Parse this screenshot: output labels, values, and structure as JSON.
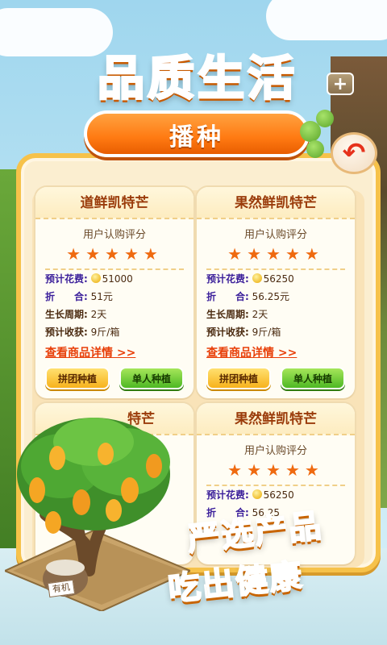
{
  "headline": "品质生活",
  "tab_label": "播种",
  "back_icon": "back-arrow-icon",
  "plus_label": "+",
  "cards": [
    {
      "title": "道鲜凯特芒",
      "rating_label": "用户认购评分",
      "stars": "★★★★★",
      "cost_label": "预计花费:",
      "cost_value": "51000",
      "discount_label": "折　　合:",
      "discount_value": "51元",
      "cycle_label": "生长周期:",
      "cycle_value": "2天",
      "harvest_label": "预计收获:",
      "harvest_value": "9斤/箱",
      "detail_link": "查看商品详情 >>",
      "group_button": "拼团种植",
      "single_button": "单人种植"
    },
    {
      "title": "果然鲜凯特芒",
      "rating_label": "用户认购评分",
      "stars": "★★★★★",
      "cost_label": "预计花费:",
      "cost_value": "56250",
      "discount_label": "折　　合:",
      "discount_value": "56.25元",
      "cycle_label": "生长周期:",
      "cycle_value": "2天",
      "harvest_label": "预计收获:",
      "harvest_value": "9斤/箱",
      "detail_link": "查看商品详情 >>",
      "group_button": "拼团种植",
      "single_button": "单人种植"
    },
    {
      "title": "特芒"
    },
    {
      "title": "果然鲜凯特芒",
      "rating_label": "用户认购评分",
      "stars": "★★★★★",
      "cost_label": "预计花费:",
      "cost_value": "56250",
      "discount_label": "折　　合:",
      "discount_value": "56.25"
    }
  ],
  "slogan_line1": "严选产品",
  "slogan_line2": "吃出健康",
  "sack_label": "有机",
  "colors": {
    "accent_orange": "#ff7a12",
    "star": "#ef6a10",
    "panel_border": "#f6c24a",
    "link": "#e8400a"
  }
}
